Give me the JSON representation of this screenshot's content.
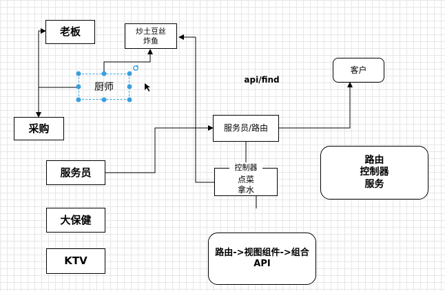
{
  "nodes": {
    "boss": "老板",
    "chef": "厨师",
    "dishes": "炒土豆丝\n炸鱼",
    "purchase": "采购",
    "waiter": "服务员",
    "spa": "大保健",
    "ktv": "KTV",
    "api_find": "api/find",
    "customer": "客户",
    "router_waiter": "服务员/路由",
    "controller": "控制器",
    "order": "点菜\n拿水",
    "summary_right": "路由\n控制器\n服务",
    "summary_bottom": "路由->视图组件->组合\nAPI"
  },
  "colors": {
    "selection": "#3aa0e0",
    "grid": "#e6e6e6",
    "line": "#000000"
  }
}
